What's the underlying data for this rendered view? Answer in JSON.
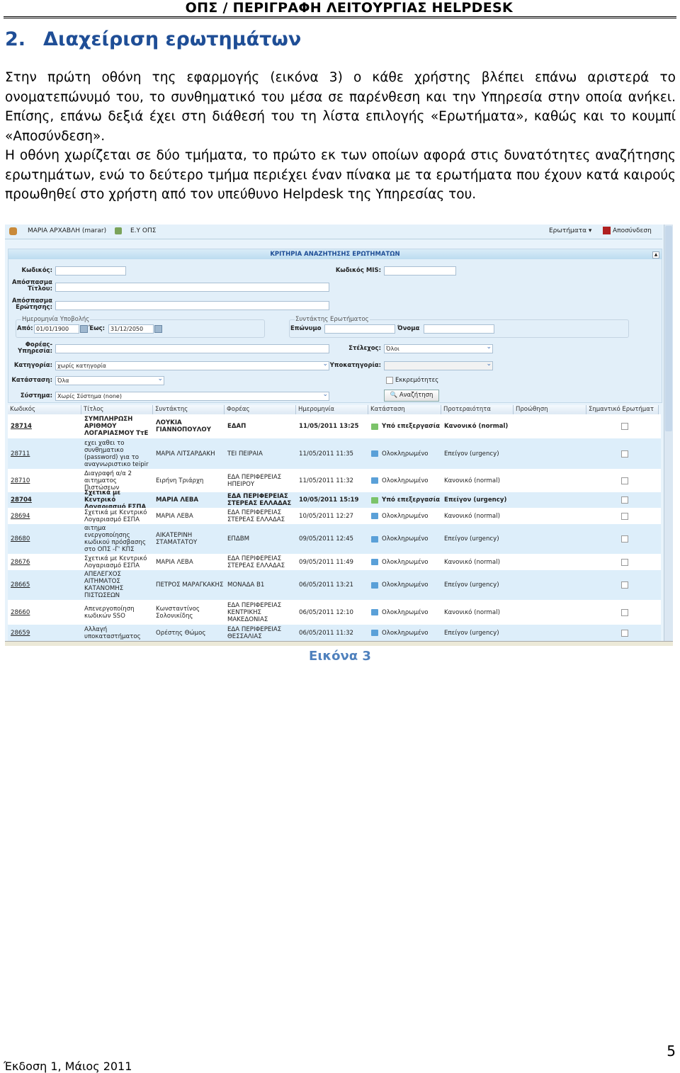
{
  "header": "ΟΠΣ / ΠΕΡΙΓΡΑΦΗ ΛΕΙΤΟΥΡΓΙΑΣ HELPDESK",
  "section": {
    "number": "2.",
    "title": "Διαχείριση ερωτημάτων"
  },
  "paragraphs": [
    "Στην πρώτη οθόνη της εφαρμογής (εικόνα 3) ο κάθε χρήστης βλέπει επάνω αριστερά το ονοματεπώνυμό του, το συνθηματικό του μέσα σε παρένθεση και την Υπηρεσία στην οποία ανήκει. Επίσης, επάνω δεξιά έχει στη διάθεσή του τη λίστα επιλογής «Ερωτήματα», καθώς και το κουμπί «Αποσύνδεση».",
    "Η οθόνη χωρίζεται σε δύο τμήματα, το πρώτο εκ των οποίων αφορά στις δυνατότητες αναζήτησης ερωτημάτων, ενώ το δεύτερο τμήμα περιέχει έναν πίνακα με τα ερωτήματα που έχουν κατά καιρούς προωθηθεί στο χρήστη από τον υπεύθυνο Helpdesk της Υπηρεσίας του."
  ],
  "app": {
    "user": "ΜΑΡΙΑ ΑΡΧΑΒΛΗ (marar)",
    "service": "Ε.Υ ΟΠΣ",
    "menu": "Ερωτήματα ▾",
    "logout": "Αποσύνδεση",
    "panel_title": "ΚΡΙΤΗΡΙΑ ΑΝΑΖΗΤΗΣΗΣ ΕΡΩΤΗΜΑΤΩΝ",
    "labels": {
      "code": "Κωδικός:",
      "mis": "Κωδικός MIS:",
      "title_excerpt": "Απόσπασμα Τίτλου:",
      "question_excerpt": "Απόσπασμα Ερώτησης:",
      "date_group": "Ημερομηνία Υποβολής",
      "from": "Από:",
      "to": "Έως:",
      "author_group": "Συντάκτης Ερωτήματος",
      "surname": "Επώνυμο",
      "name": "Όνομα",
      "agency": "Φορέας-Υπηρεσία:",
      "staff": "Στέλεχος:",
      "category": "Κατηγορία:",
      "subcategory": "Υποκατηγορία:",
      "status": "Κατάσταση:",
      "pending": "Εκκρεμότητες",
      "system": "Σύστημα:"
    },
    "values": {
      "from": "01/01/1900",
      "to": "31/12/2050",
      "staff": "Όλοι",
      "category": "χωρίς κατηγορία",
      "status": "Όλα",
      "system": "Χωρίς Σύστημα (none)"
    },
    "search_button": "Αναζήτηση",
    "columns": [
      "Κωδικός",
      "Τίτλος",
      "Συντάκτης",
      "Φορέας",
      "Ημερομηνία",
      "Κατάσταση",
      "Προτεραιότητα",
      "Προώθηση",
      "Σημαντικό Ερωτήματ"
    ],
    "rows": [
      {
        "code": "28714",
        "title": "ΣΥΜΠΛΗΡΩΣΗ ΑΡΙΘΜΟΥ ΛΟΓΑΡΙΑΣΜΟΥ ΤτΕ",
        "author": "ΛΟΥΚΙΑ ΓΙΑΝΝΟΠΟΥΛΟΥ",
        "agency": "ΕΔΑΠ",
        "date": "11/05/2011 13:25",
        "status": "Υπό επεξεργασία",
        "priority": "Κανονικό (normal)",
        "bold": true
      },
      {
        "code": "28711",
        "title": "εχει χαθει το συνθηματικο (password) για το αναγνωριστικο teipir",
        "author": "ΜΑΡΙΑ ΛΙΤΣΑΡΔΑΚΗ",
        "agency": "ΤΕΙ ΠΕΙΡΑΙΑ",
        "date": "11/05/2011 11:35",
        "status": "Ολοκληρωμένο",
        "priority": "Επείγον (urgency)",
        "bold": false
      },
      {
        "code": "28710",
        "title": "Διαγραφή α/α 2 αιτηματος Πιστώσεων",
        "author": "Ειρήνη Τριάρχη",
        "agency": "ΕΔΑ ΠΕΡΙΦΕΡΕΙΑΣ ΗΠΕΙΡΟΥ",
        "date": "11/05/2011 11:32",
        "status": "Ολοκληρωμένο",
        "priority": "Κανονικό (normal)",
        "bold": false
      },
      {
        "code": "28704",
        "title": "Σχετικά με Κεντρικό Λογαριασμό ΕΣΠΑ",
        "author": "ΜΑΡΙΑ ΛΕΒΑ",
        "agency": "ΕΔΑ ΠΕΡΙΦΕΡΕΙΑΣ ΣΤΕΡΕΑΣ ΕΛΛΑΔΑΣ",
        "date": "10/05/2011 15:19",
        "status": "Υπό επεξεργασία",
        "priority": "Επείγον (urgency)",
        "bold": true
      },
      {
        "code": "28694",
        "title": "Σχετικά με Κεντρικό Λογαριασμό ΕΣΠΑ",
        "author": "ΜΑΡΙΑ ΛΕΒΑ",
        "agency": "ΕΔΑ ΠΕΡΙΦΕΡΕΙΑΣ ΣΤΕΡΕΑΣ ΕΛΛΑΔΑΣ",
        "date": "10/05/2011 12:27",
        "status": "Ολοκληρωμένο",
        "priority": "Κανονικό (normal)",
        "bold": false
      },
      {
        "code": "28680",
        "title": "αιτημα ενεργοποίησης κωδικού πρόσβασης στο ΟΠΣ -Γ' ΚΠΣ",
        "author": "ΑΙΚΑΤΕΡΙΝΗ ΣΤΑΜΑΤΑΤΟΥ",
        "agency": "ΕΠΔΒΜ",
        "date": "09/05/2011 12:45",
        "status": "Ολοκληρωμένο",
        "priority": "Επείγον (urgency)",
        "bold": false
      },
      {
        "code": "28676",
        "title": "Σχετικά με Κεντρικό Λογαριασμό ΕΣΠΑ",
        "author": "ΜΑΡΙΑ ΛΕΒΑ",
        "agency": "ΕΔΑ ΠΕΡΙΦΕΡΕΙΑΣ ΣΤΕΡΕΑΣ ΕΛΛΑΔΑΣ",
        "date": "09/05/2011 11:49",
        "status": "Ολοκληρωμένο",
        "priority": "Κανονικό (normal)",
        "bold": false
      },
      {
        "code": "28665",
        "title": "ΑΠΕΛΕΓΧΟΣ ΑΙΤΗΜΑΤΟΣ ΚΑΤΑΝΟΜΗΣ ΠΙΣΤΩΣΕΩΝ",
        "author": "ΠΕΤΡΟΣ ΜΑΡΑΓΚΑΚΗΣ",
        "agency": "ΜΟΝΑΔΑ Β1",
        "date": "06/05/2011 13:21",
        "status": "Ολοκληρωμένο",
        "priority": "Επείγον (urgency)",
        "bold": false
      },
      {
        "code": "28660",
        "title": "Απενεργοποίηση κωδικών SSO",
        "author": "Κωνσταντίνος Σολονικίδης",
        "agency": "ΕΔΑ ΠΕΡΙΦΕΡΕΙΑΣ ΚΕΝΤΡΙΚΗΣ ΜΑΚΕΔΟΝΙΑΣ",
        "date": "06/05/2011 12:10",
        "status": "Ολοκληρωμένο",
        "priority": "Κανονικό (normal)",
        "bold": false
      },
      {
        "code": "28659",
        "title": "Αλλαγή υποκαταστήματος",
        "author": "Ορέστης Θώμος",
        "agency": "ΕΔΑ ΠΕΡΙΦΕΡΕΙΑΣ ΘΕΣΣΑΛΙΑΣ",
        "date": "06/05/2011 11:32",
        "status": "Ολοκληρωμένο",
        "priority": "Επείγον (urgency)",
        "bold": false
      }
    ]
  },
  "caption": "Εικόνα 3",
  "footer": "Έκδοση 1, Μάιος 2011",
  "page_number": "5"
}
